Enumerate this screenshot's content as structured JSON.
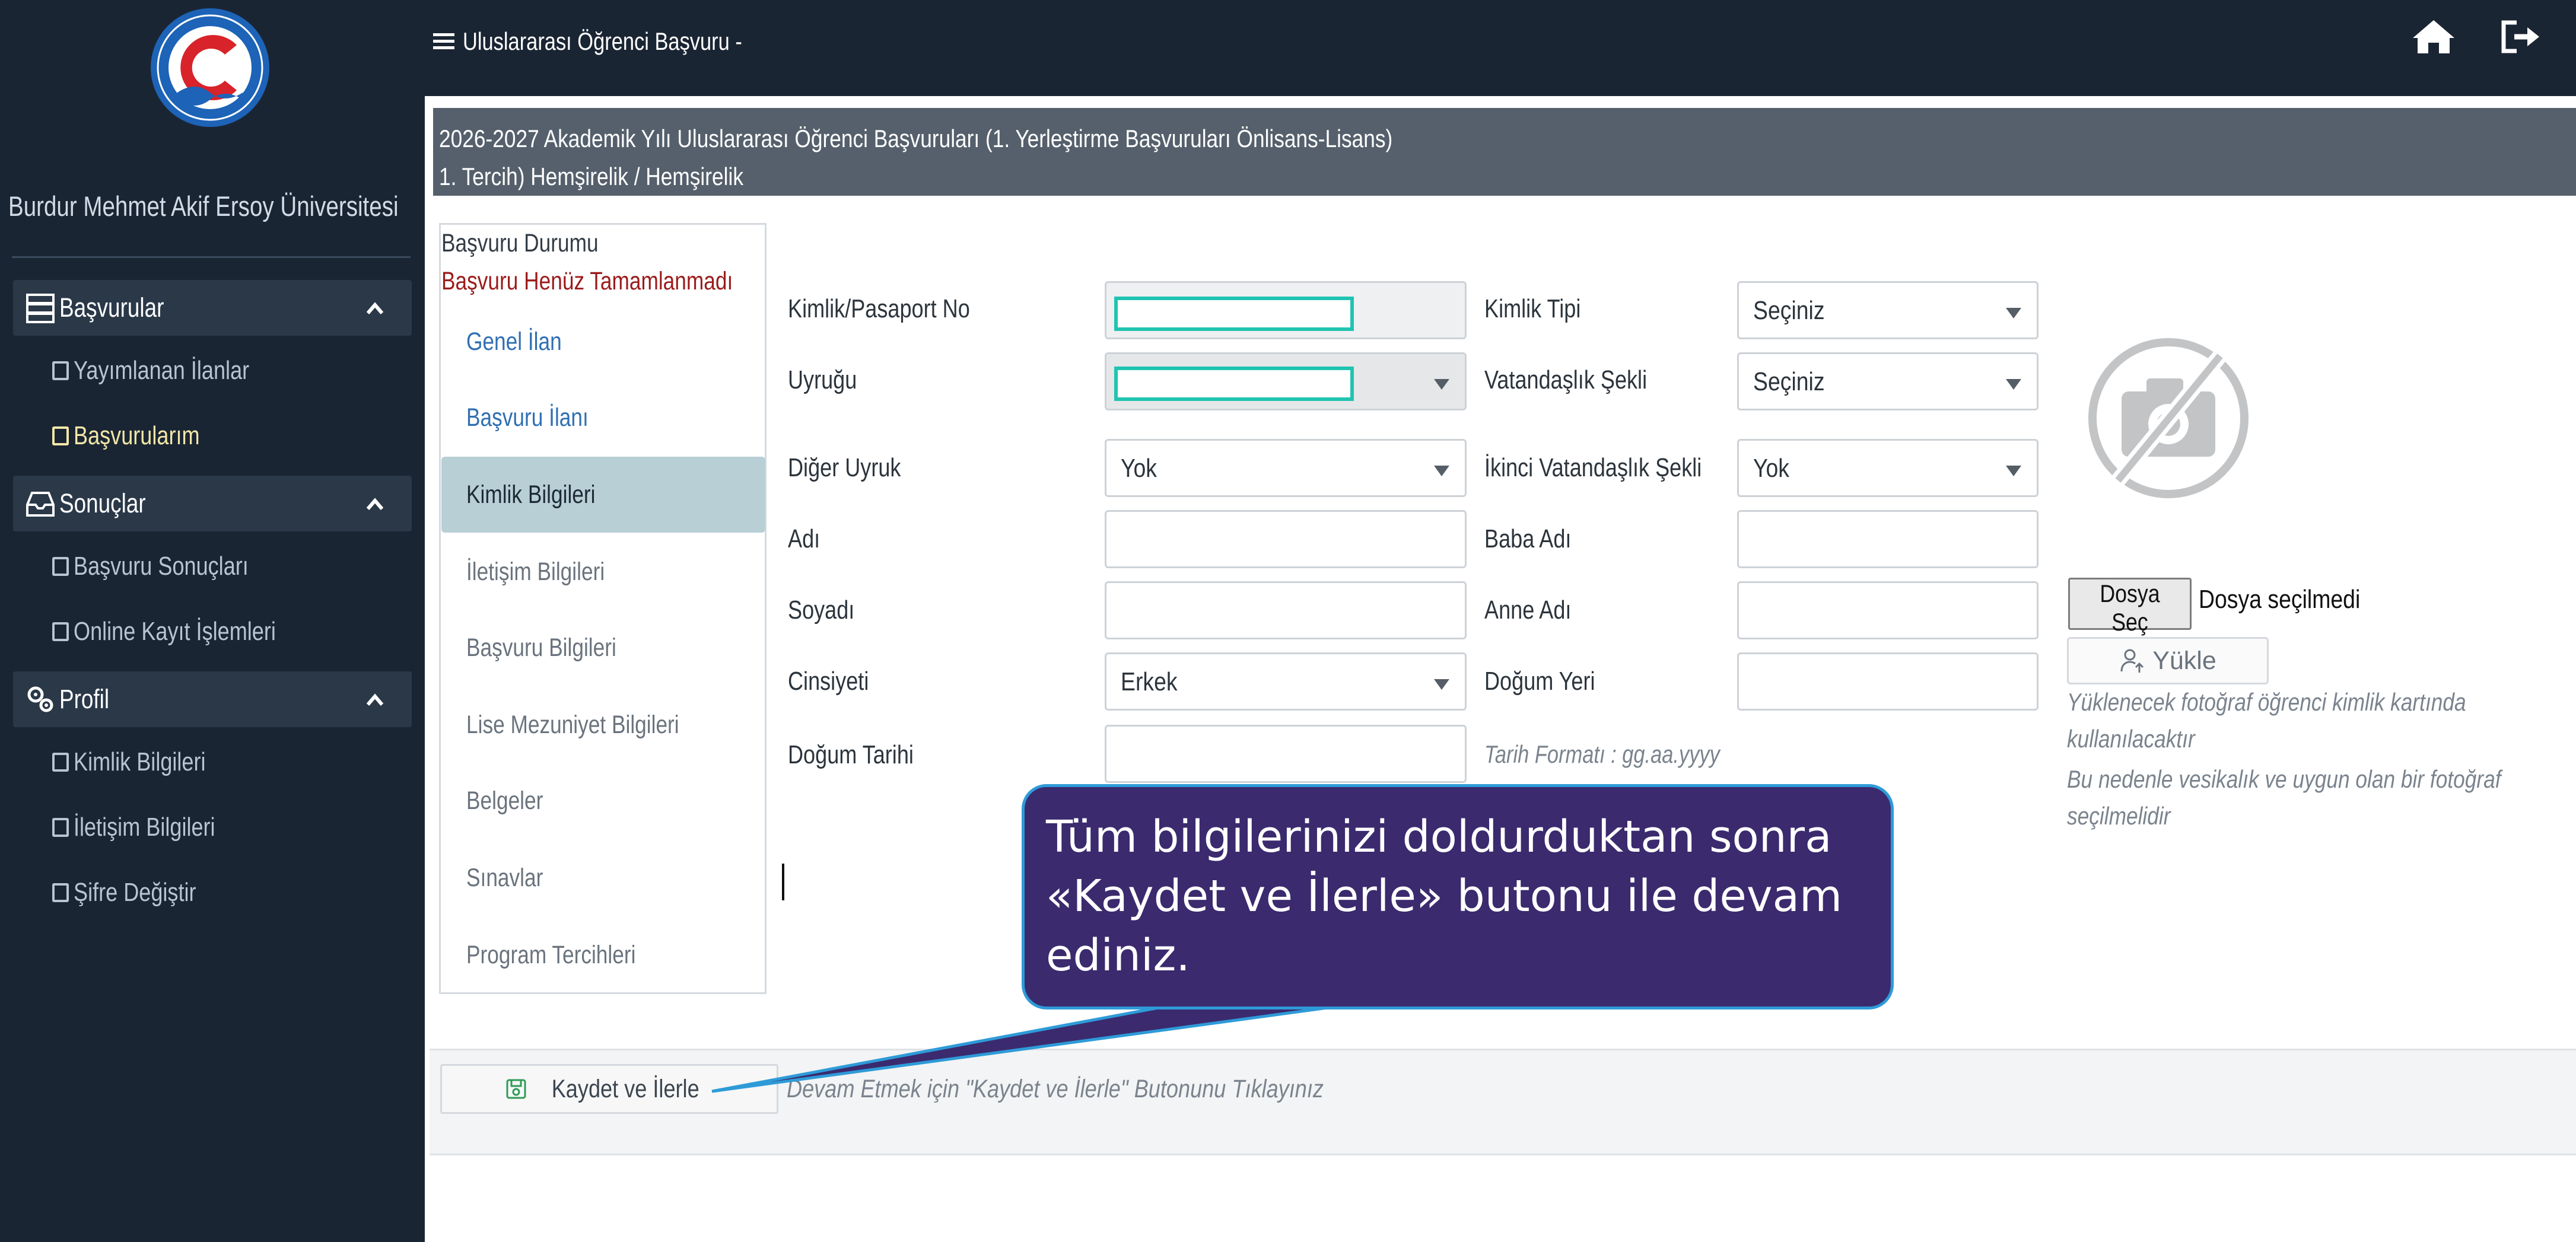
{
  "sidebar": {
    "university_name": "Burdur Mehmet Akif Ersoy Üniversitesi",
    "logo": {
      "icon": "university-logo"
    },
    "groups": [
      {
        "label": "Başvurular",
        "icon": "applications-icon",
        "items": [
          {
            "label": "Yayımlanan İlanlar",
            "active": false
          },
          {
            "label": "Başvurularım",
            "active": true
          }
        ]
      },
      {
        "label": "Sonuçlar",
        "icon": "inbox-icon",
        "items": [
          {
            "label": "Başvuru Sonuçları",
            "active": false
          },
          {
            "label": "Online Kayıt İşlemleri",
            "active": false
          }
        ]
      },
      {
        "label": "Profil",
        "icon": "gears-icon",
        "items": [
          {
            "label": "Kimlik Bilgileri",
            "active": false
          },
          {
            "label": "İletişim Bilgileri",
            "active": false
          },
          {
            "label": "Şifre Değiştir",
            "active": false
          }
        ]
      }
    ]
  },
  "topbar": {
    "title": "Uluslararası Öğrenci Başvuru -",
    "icons": [
      "menu-icon",
      "home-icon",
      "logout-icon"
    ]
  },
  "page_header": {
    "line1": "2026-2027 Akademik Yılı Uluslararası Öğrenci Başvuruları (1. Yerleştirme Başvuruları Önlisans-Lisans)",
    "line2": "1. Tercih) Hemşirelik / Hemşirelik"
  },
  "status": {
    "label": "Başvuru Durumu",
    "value": "Başvuru Henüz Tamamlanmadı"
  },
  "steps": [
    {
      "label": "Genel İlan",
      "state": "link"
    },
    {
      "label": "Başvuru İlanı",
      "state": "link"
    },
    {
      "label": "Kimlik Bilgileri",
      "state": "active"
    },
    {
      "label": "İletişim Bilgileri",
      "state": "disabled"
    },
    {
      "label": "Başvuru Bilgileri",
      "state": "disabled"
    },
    {
      "label": "Lise Mezuniyet Bilgileri",
      "state": "disabled"
    },
    {
      "label": "Belgeler",
      "state": "disabled"
    },
    {
      "label": "Sınavlar",
      "state": "disabled"
    },
    {
      "label": "Program Tercihleri",
      "state": "disabled"
    }
  ],
  "form": {
    "kimlik_no": {
      "label": "Kimlik/Pasaport No",
      "value": ""
    },
    "kimlik_tipi": {
      "label": "Kimlik Tipi",
      "value": "Seçiniz"
    },
    "uyrugu": {
      "label": "Uyruğu",
      "value": ""
    },
    "vatandaslik_sekli": {
      "label": "Vatandaşlık Şekli",
      "value": "Seçiniz"
    },
    "diger_uyruk": {
      "label": "Diğer Uyruk",
      "value": "Yok"
    },
    "ikinci_vatandaslik": {
      "label": "İkinci Vatandaşlık Şekli",
      "value": "Yok"
    },
    "adi": {
      "label": "Adı",
      "value": ""
    },
    "baba_adi": {
      "label": "Baba Adı",
      "value": ""
    },
    "soyadi": {
      "label": "Soyadı",
      "value": ""
    },
    "anne_adi": {
      "label": "Anne Adı",
      "value": ""
    },
    "cinsiyeti": {
      "label": "Cinsiyeti",
      "value": "Erkek"
    },
    "dogum_yeri": {
      "label": "Doğum Yeri",
      "value": ""
    },
    "dogum_tarihi": {
      "label": "Doğum Tarihi",
      "value": "",
      "hint": "Tarih Formatı : gg.aa.yyyy"
    }
  },
  "photo": {
    "icon": "no-camera-icon",
    "file_button": "Dosya Seç",
    "file_status": "Dosya seçilmedi",
    "upload_label": "Yükle",
    "notes": [
      "Yüklenecek fotoğraf öğrenci kimlik kartında",
      "kullanılacaktır",
      "Bu nedenle vesikalık ve uygun olan bir fotoğraf",
      "seçilmelidir"
    ]
  },
  "footer": {
    "save_label": "Kaydet ve İlerle",
    "hint": "Devam Etmek için \"Kaydet ve İlerle\" Butonunu Tıklayınız"
  },
  "callout": {
    "lines": [
      "Tüm bilgilerinizi doldurduktan sonra",
      "«Kaydet ve İlerle» butonu ile devam",
      "ediniz."
    ]
  },
  "colors": {
    "sidebar_bg": "#1a2533",
    "header_bg": "#55606c",
    "active_step": "#b8cfd6",
    "status_red": "#9b1b1b",
    "callout_bg": "#3b2a6e",
    "callout_border": "#2e9bd8",
    "highlight": "#20c4b0"
  }
}
